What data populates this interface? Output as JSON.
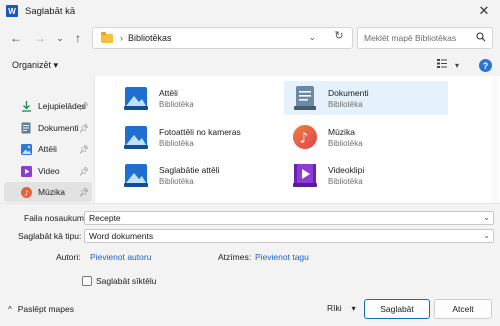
{
  "window": {
    "title": "Saglabāt kā",
    "app_icon_letter": "W"
  },
  "nav": {
    "address": "Bibliotēkas",
    "search_placeholder": "Meklēt mapē Bibliotēkas"
  },
  "toolbar": {
    "organize_label": "Organizēt",
    "organize_caret": "▾",
    "help": "?"
  },
  "sidebar": {
    "items": [
      {
        "label": "Lejupielādes",
        "icon": "download-icon"
      },
      {
        "label": "Dokumenti",
        "icon": "documents-icon"
      },
      {
        "label": "Attēli",
        "icon": "pictures-icon"
      },
      {
        "label": "Video",
        "icon": "video-icon"
      },
      {
        "label": "Mūzika",
        "icon": "music-icon",
        "selected": true
      }
    ]
  },
  "libraries": [
    {
      "name": "Attēli",
      "type": "Bibliotēka",
      "icon": "pictures-library-icon"
    },
    {
      "name": "Dokumenti",
      "type": "Bibliotēka",
      "icon": "documents-library-icon",
      "selected": true
    },
    {
      "name": "Fotoattēli no kameras",
      "type": "Bibliotēka",
      "icon": "camera-roll-library-icon"
    },
    {
      "name": "Mūzika",
      "type": "Bibliotēka",
      "icon": "music-library-icon"
    },
    {
      "name": "Saglabātie attēli",
      "type": "Bibliotēka",
      "icon": "saved-pictures-library-icon"
    },
    {
      "name": "Videoklipi",
      "type": "Bibliotēka",
      "icon": "videos-library-icon"
    }
  ],
  "form": {
    "filename_label": "Faila nosaukums:",
    "filename_value": "Recepte",
    "type_label": "Saglabāt kā tipu:",
    "type_value": "Word dokuments",
    "authors_label": "Autori:",
    "authors_link": "Pievienot autoru",
    "tags_label": "Atzīmes:",
    "tags_link": "Pievienot tagu",
    "thumbnail_label": "Saglabāt sīktēlu"
  },
  "footer": {
    "hide_folders": "Paslēpt mapes",
    "tools": "Rīki",
    "save": "Saglabāt",
    "cancel": "Atcelt"
  },
  "colors": {
    "accent": "#0f6cbd",
    "link": "#1a62c6",
    "selection": "#e5f1fb"
  }
}
